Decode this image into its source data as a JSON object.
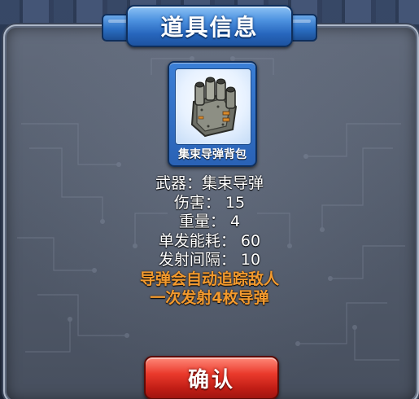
{
  "dialog": {
    "title": "道具信息",
    "item": {
      "name": "集束导弹背包",
      "icon": "missile-backpack-icon"
    },
    "info_lines": [
      "武器：集束导弹",
      "伤害： 15",
      "重量： 4",
      "单发能耗： 60",
      "发射间隔： 10"
    ],
    "description_lines": [
      "导弹会自动追踪敌人",
      "一次发射4枚导弹"
    ],
    "confirm_label": "确认"
  },
  "colors": {
    "title_blue": "#2b6fc4",
    "description_orange": "#f39a2e",
    "confirm_red": "#ea3a2c"
  }
}
